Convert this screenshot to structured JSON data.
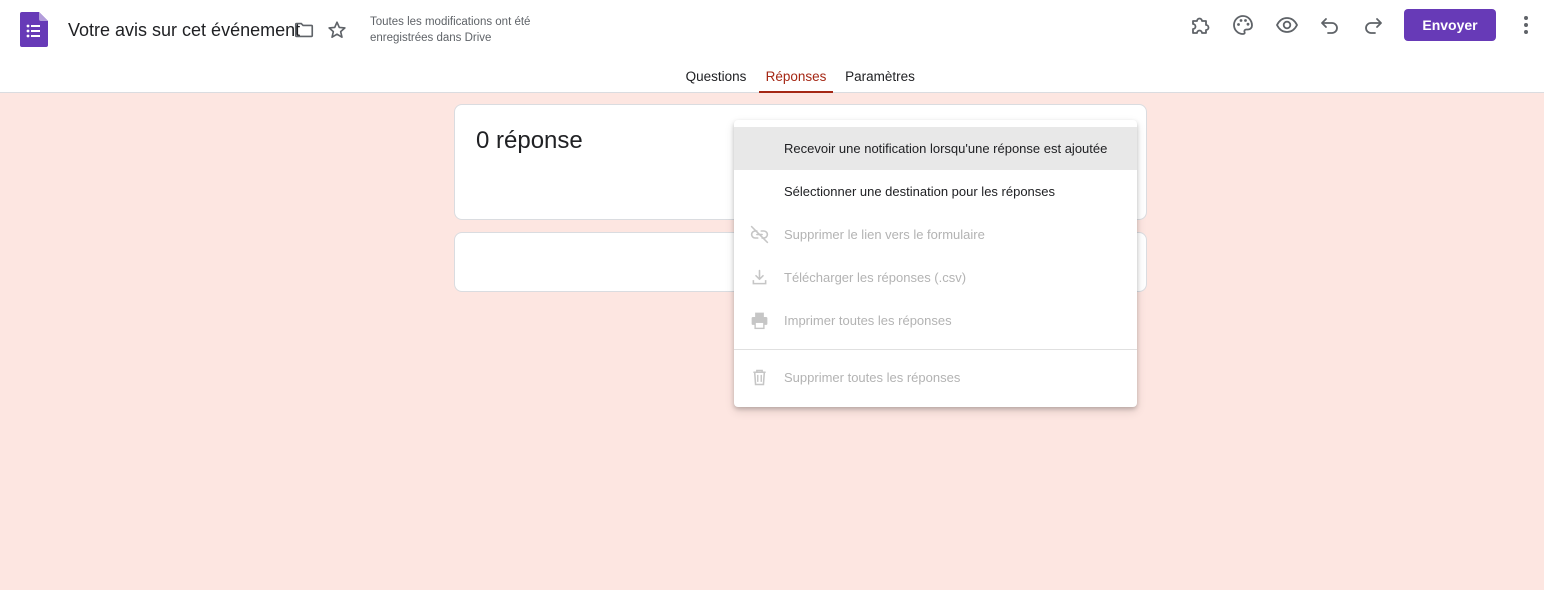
{
  "header": {
    "title": "Votre avis sur cet événement",
    "save_status": "Toutes les modifications ont été enregistrées dans Drive",
    "send_label": "Envoyer",
    "brand_color": "#673ab7",
    "icons": [
      "forms-logo-icon",
      "folder-icon",
      "star-icon",
      "addons-puzzle-icon",
      "palette-icon",
      "preview-eye-icon",
      "undo-icon",
      "redo-icon",
      "more-vert-icon"
    ]
  },
  "tabs": [
    {
      "label": "Questions",
      "active": false
    },
    {
      "label": "Réponses",
      "active": true
    },
    {
      "label": "Paramètres",
      "active": false
    }
  ],
  "summary": {
    "count_label": "0 réponse"
  },
  "menu": {
    "items": [
      {
        "label": "Recevoir une notification lorsqu'une réponse est ajoutée",
        "enabled": true,
        "highlighted": true,
        "icon": ""
      },
      {
        "label": "Sélectionner une destination pour les réponses",
        "enabled": true,
        "highlighted": false,
        "icon": ""
      },
      {
        "label": "Supprimer le lien vers le formulaire",
        "enabled": false,
        "highlighted": false,
        "icon": "link-off-icon"
      },
      {
        "label": "Télécharger les réponses (.csv)",
        "enabled": false,
        "highlighted": false,
        "icon": "download-icon"
      },
      {
        "label": "Imprimer toutes les réponses",
        "enabled": false,
        "highlighted": false,
        "icon": "print-icon"
      },
      {
        "label": "Supprimer toutes les réponses",
        "enabled": false,
        "highlighted": false,
        "icon": "trash-icon"
      }
    ]
  },
  "colors": {
    "background": "#fde6e1",
    "active_tab": "#a52714"
  }
}
